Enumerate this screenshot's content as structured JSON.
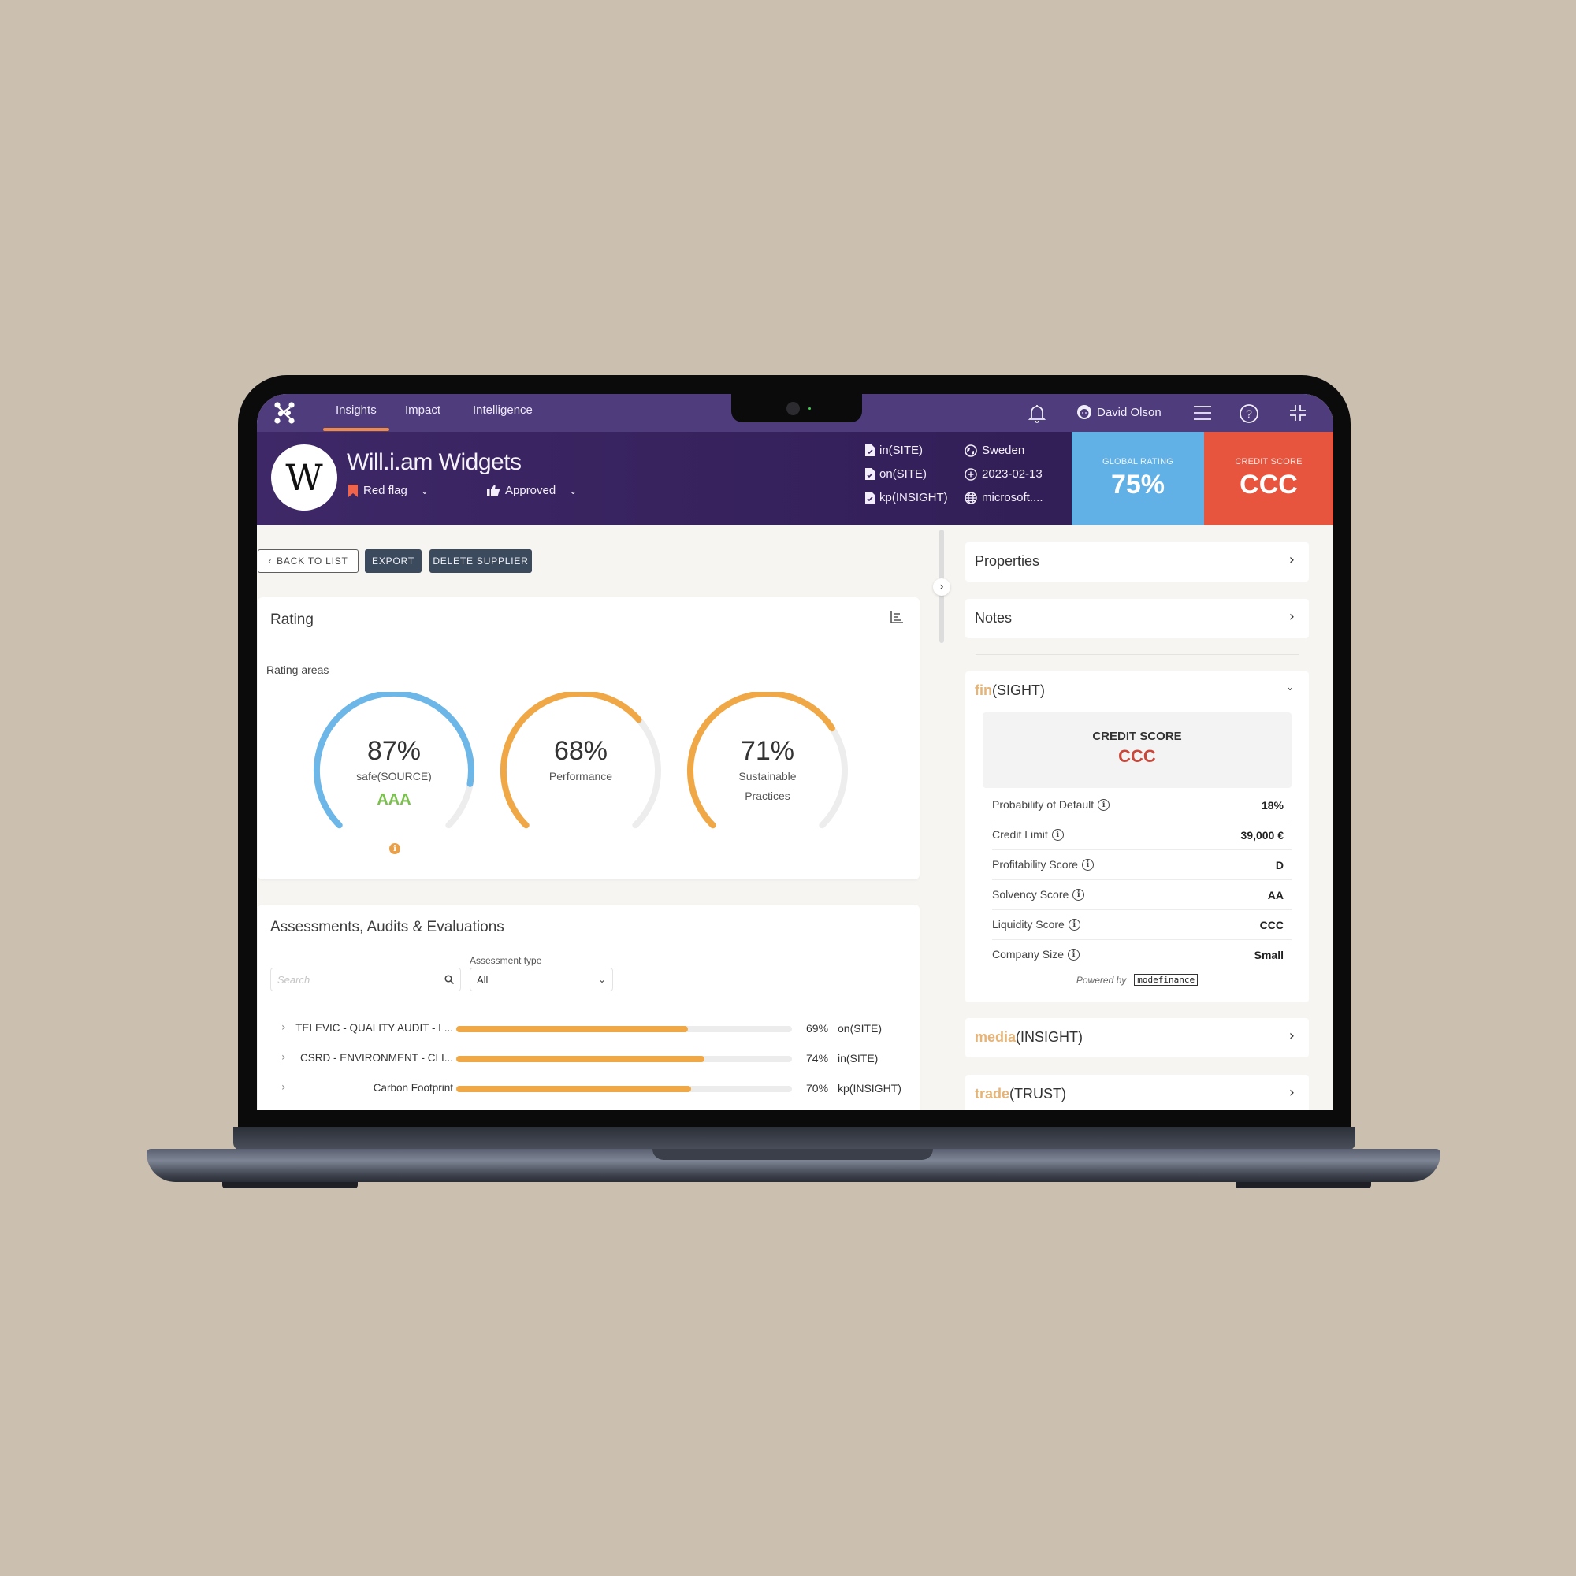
{
  "nav": {
    "tabs": [
      {
        "label": "Insights",
        "active": true
      },
      {
        "label": "Impact",
        "active": false
      },
      {
        "label": "Intelligence",
        "active": false
      }
    ],
    "user_name": "David Olson",
    "icons": [
      "bell-icon",
      "user-avatar-icon",
      "menu-icon",
      "help-icon",
      "collapse-icon"
    ]
  },
  "header": {
    "logo_letter": "W",
    "company_name": "Will.i.am Widgets",
    "flag_label": "Red flag",
    "status_label": "Approved",
    "sources": [
      "in(SITE)",
      "on(SITE)",
      "kp(INSIGHT)"
    ],
    "country": "Sweden",
    "date": "2023-02-13",
    "website": "microsoft....",
    "global_rating": {
      "label": "GLOBAL RATING",
      "value": "75%",
      "color": "#62b1e6"
    },
    "credit_score": {
      "label": "CREDIT SCORE",
      "value": "CCC",
      "color": "#e8553e"
    }
  },
  "actions": {
    "back": "BACK TO LIST",
    "export": "EXPORT",
    "delete": "DELETE SUPPLIER"
  },
  "rating": {
    "title": "Rating",
    "subtitle": "Rating areas",
    "gauges": [
      {
        "pct_label": "87%",
        "value": 87,
        "label": "safe(SOURCE)",
        "label2": "",
        "grade": "AAA",
        "color": "#6cb6e8"
      },
      {
        "pct_label": "68%",
        "value": 68,
        "label": "Performance",
        "label2": "",
        "grade": "",
        "color": "#f0a846"
      },
      {
        "pct_label": "71%",
        "value": 71,
        "label": "Sustainable",
        "label2": "Practices",
        "grade": "",
        "color": "#f0a846"
      }
    ]
  },
  "assessments": {
    "title": "Assessments, Audits & Evaluations",
    "search_placeholder": "Search",
    "type_label": "Assessment type",
    "type_value": "All",
    "rows": [
      {
        "name": "TELEVIC - QUALITY AUDIT - L...",
        "pct": 69,
        "pct_label": "69%",
        "source": "on(SITE)"
      },
      {
        "name": "CSRD - ENVIRONMENT - CLI...",
        "pct": 74,
        "pct_label": "74%",
        "source": "in(SITE)"
      },
      {
        "name": "Carbon Footprint",
        "pct": 70,
        "pct_label": "70%",
        "source": "kp(INSIGHT)"
      }
    ]
  },
  "right": {
    "properties": "Properties",
    "notes": "Notes",
    "fin": {
      "brand": "fin",
      "suffix": "(SIGHT)"
    },
    "credit_title": "CREDIT SCORE",
    "credit_value": "CCC",
    "rows": [
      {
        "key": "Probability of Default",
        "value": "18%"
      },
      {
        "key": "Credit Limit",
        "value": "39,000 €"
      },
      {
        "key": "Profitability Score",
        "value": "D"
      },
      {
        "key": "Solvency Score",
        "value": "AA"
      },
      {
        "key": "Liquidity Score",
        "value": "CCC"
      },
      {
        "key": "Company Size",
        "value": "Small"
      }
    ],
    "powered_by": "Powered by",
    "provider": "modefinance",
    "media": {
      "brand": "media",
      "suffix": "(INSIGHT)"
    },
    "trade": {
      "brand": "trade",
      "suffix": "(TRUST)"
    }
  }
}
